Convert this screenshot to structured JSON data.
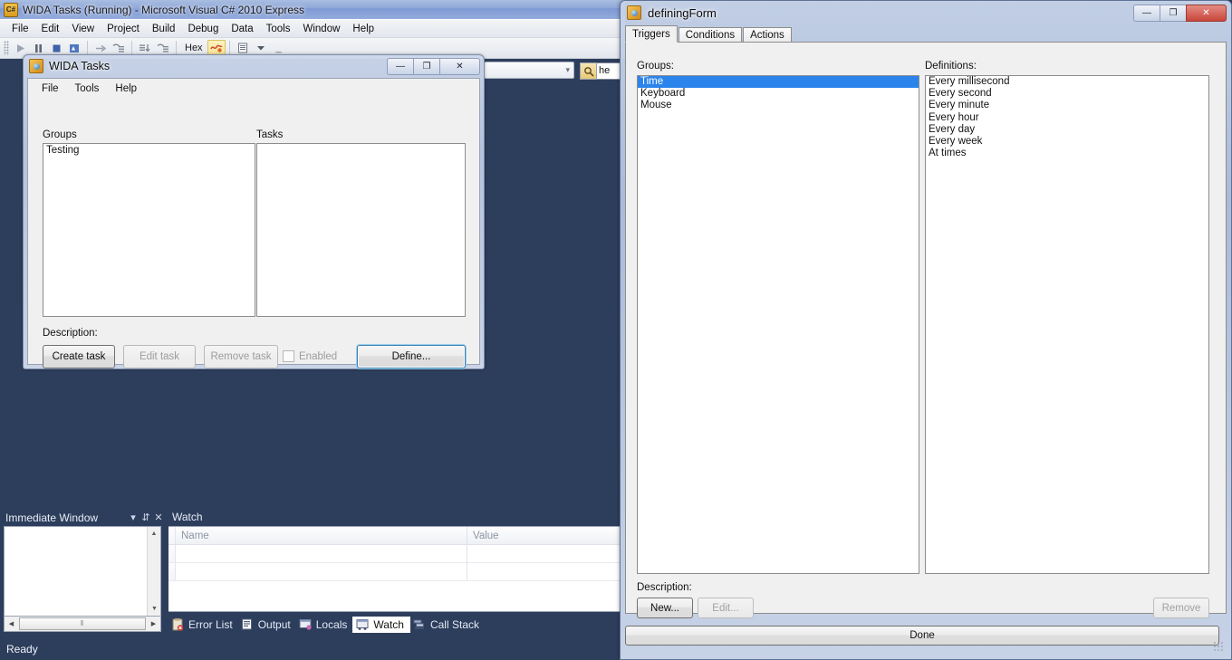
{
  "vs": {
    "title": "WIDA Tasks (Running) - Microsoft Visual C# 2010 Express",
    "app_icon": "csharp-icon",
    "menu": [
      "File",
      "Edit",
      "View",
      "Project",
      "Build",
      "Debug",
      "Data",
      "Tools",
      "Window",
      "Help"
    ],
    "toolbar": {
      "hex_label": "Hex",
      "buttons": [
        "continue-icon",
        "break-all-icon",
        "stop-debugging-icon",
        "restart-icon",
        "step-over-icon",
        "step-into-icon",
        "step-out-icon",
        "show-next-statement-icon",
        "hex-display-icon",
        "highlight-icon",
        "windows-icon",
        "dropdown-icon"
      ],
      "overflow_label": "_"
    },
    "search": {
      "value": "he",
      "icon": "find-icon"
    },
    "combo": {
      "value": "",
      "icon": "chevron-down-icon"
    },
    "immediate_window": {
      "title": "Immediate Window",
      "dropdown_icon": "chevron-down-icon",
      "pin_icon": "pin-icon",
      "close_icon": "close-icon",
      "content": "",
      "scroll_up_icon": "scroll-up-icon",
      "scroll_down_icon": "scroll-down-icon",
      "scroll_left_icon": "scroll-left-icon",
      "scroll_right_icon": "scroll-right-icon",
      "thumb_grip": "⦀"
    },
    "watch_window": {
      "title": "Watch",
      "columns": [
        "Name",
        "Value"
      ],
      "rows": [
        {
          "name": "",
          "value": ""
        },
        {
          "name": "",
          "value": ""
        }
      ]
    },
    "bottom_tabs": [
      {
        "label": "Error List",
        "icon": "error-list-icon",
        "active": false
      },
      {
        "label": "Output",
        "icon": "output-icon",
        "active": false
      },
      {
        "label": "Locals",
        "icon": "locals-icon",
        "active": false
      },
      {
        "label": "Watch",
        "icon": "watch-icon",
        "active": true
      },
      {
        "label": "Call Stack",
        "icon": "call-stack-icon",
        "active": false
      }
    ],
    "status": "Ready"
  },
  "wida": {
    "title": "WIDA Tasks",
    "icon": "app-icon",
    "window_buttons": {
      "minimize": "—",
      "maximize": "❐",
      "close": "✕"
    },
    "menu": [
      "File",
      "Tools",
      "Help"
    ],
    "groups_label": "Groups",
    "tasks_label": "Tasks",
    "groups": [
      "Testing"
    ],
    "tasks": [],
    "description_label": "Description:",
    "buttons": {
      "create_task": "Create task",
      "edit_task": "Edit task",
      "remove_task": "Remove task",
      "define": "Define..."
    },
    "enabled_checkbox": {
      "label": "Enabled",
      "checked": false
    }
  },
  "dform": {
    "title": "definingForm",
    "icon": "app-icon",
    "window_buttons": {
      "minimize": "—",
      "maximize": "❐",
      "close": "✕"
    },
    "tabs": [
      {
        "label": "Triggers",
        "active": true
      },
      {
        "label": "Conditions",
        "active": false
      },
      {
        "label": "Actions",
        "active": false
      }
    ],
    "groups_label": "Groups:",
    "definitions_label": "Definitions:",
    "groups": [
      {
        "label": "Time",
        "selected": true
      },
      {
        "label": "Keyboard",
        "selected": false
      },
      {
        "label": "Mouse",
        "selected": false
      }
    ],
    "definitions": [
      "Every millisecond",
      "Every second",
      "Every minute",
      "Every hour",
      "Every day",
      "Every week",
      "At times"
    ],
    "description_label": "Description:",
    "buttons": {
      "new": "New...",
      "edit": "Edit...",
      "remove": "Remove",
      "done": "Done"
    },
    "resize_grip": "resize-grip-icon"
  },
  "colors": {
    "vs_background": "#2d3e5c",
    "selection_blue": "#2a84ec",
    "focus_blue": "#3c7fb1",
    "close_red": "#c9453a",
    "dialog_face": "#f0f0f0"
  }
}
